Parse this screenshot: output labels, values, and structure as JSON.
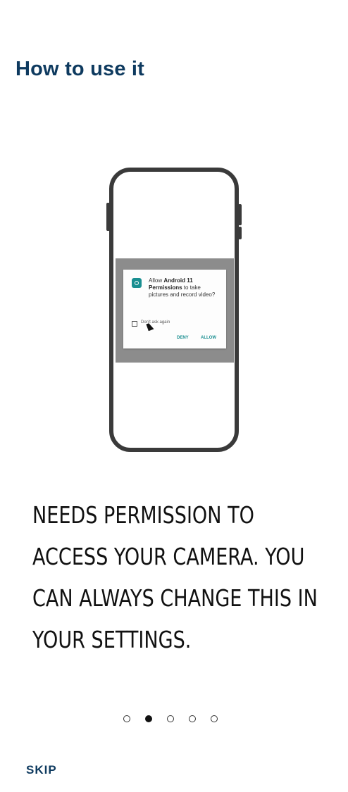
{
  "header": {
    "title": "How to use it"
  },
  "illustration": {
    "dialog_prefix": "Allow ",
    "dialog_app": "Android 11 Permissions",
    "dialog_suffix": " to take pictures and record video?",
    "checkbox_label": "Don't ask again",
    "deny_label": "DENY",
    "allow_label": "ALLOW"
  },
  "onboarding": {
    "description": "Needs permission to access your camera. You can always change this in your settings.",
    "page_count": 5,
    "current_page": 2
  },
  "footer": {
    "skip_label": "SKIP"
  },
  "colors": {
    "title": "#0e3a5f",
    "accent": "#1a8f91"
  }
}
